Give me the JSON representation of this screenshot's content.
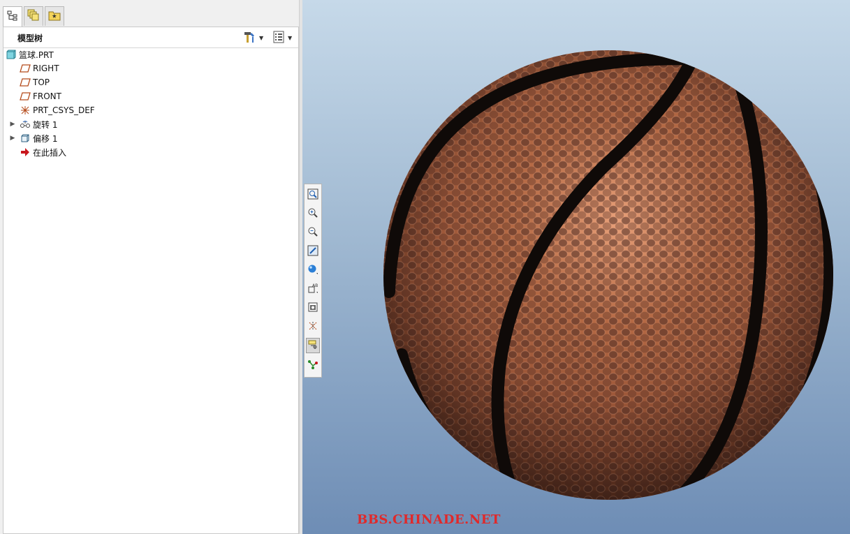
{
  "tabs": [
    {
      "icon": "model-tree-icon"
    },
    {
      "icon": "layers-icon"
    },
    {
      "icon": "favorites-folder-icon"
    }
  ],
  "tree": {
    "title": "模型树",
    "settings_icon": "tree-settings-icon",
    "columns_icon": "tree-columns-icon",
    "items": [
      {
        "label": "篮球.PRT",
        "icon": "part-icon",
        "expandable": false
      },
      {
        "label": "RIGHT",
        "icon": "datum-plane-icon",
        "expandable": false
      },
      {
        "label": "TOP",
        "icon": "datum-plane-icon",
        "expandable": false
      },
      {
        "label": "FRONT",
        "icon": "datum-plane-icon",
        "expandable": false
      },
      {
        "label": "PRT_CSYS_DEF",
        "icon": "coordinate-system-icon",
        "expandable": false
      },
      {
        "label": "旋转 1",
        "icon": "revolve-feature-icon",
        "expandable": true
      },
      {
        "label": "偏移 1",
        "icon": "offset-feature-icon",
        "expandable": true
      },
      {
        "label": "在此插入",
        "icon": "insert-here-arrow-icon",
        "expandable": false
      }
    ]
  },
  "view_toolbar": {
    "buttons": [
      {
        "name": "refit-icon"
      },
      {
        "name": "zoom-in-icon"
      },
      {
        "name": "zoom-out-icon"
      },
      {
        "name": "repaint-icon"
      },
      {
        "name": "display-style-icon"
      },
      {
        "name": "saved-orientations-icon"
      },
      {
        "name": "view-manager-icon"
      },
      {
        "name": "datum-display-icon"
      },
      {
        "name": "annotation-display-icon",
        "pressed": true
      },
      {
        "name": "spin-center-icon"
      }
    ]
  },
  "viewport": {
    "model": "basketball",
    "ball_color": "#a65a36",
    "seam_color": "#0f0a08"
  },
  "watermark": "BBS.CHINADE.NET"
}
